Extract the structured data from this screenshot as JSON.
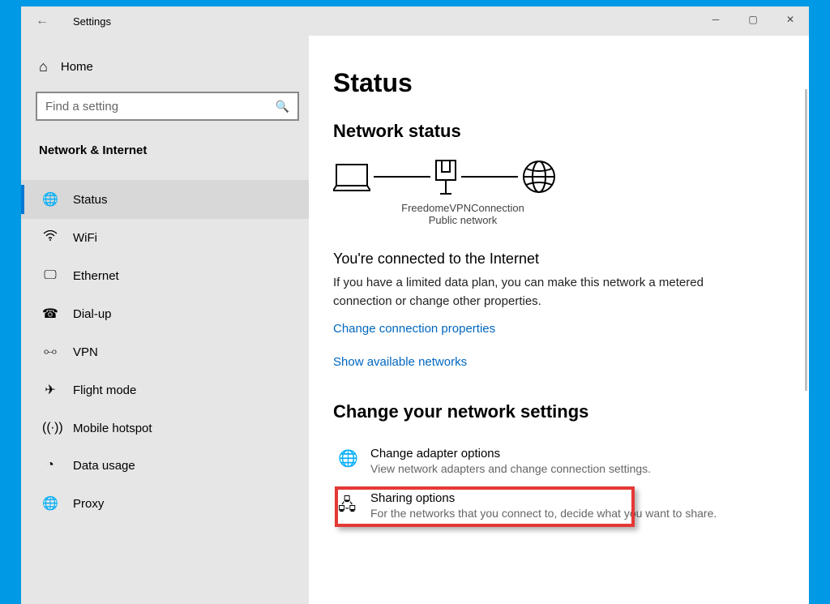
{
  "titlebar": {
    "title": "Settings"
  },
  "sidebar": {
    "home": "Home",
    "search_placeholder": "Find a setting",
    "section": "Network & Internet",
    "items": [
      {
        "label": "Status",
        "selected": true
      },
      {
        "label": "WiFi"
      },
      {
        "label": "Ethernet"
      },
      {
        "label": "Dial-up"
      },
      {
        "label": "VPN"
      },
      {
        "label": "Flight mode"
      },
      {
        "label": "Mobile hotspot"
      },
      {
        "label": "Data usage"
      },
      {
        "label": "Proxy"
      }
    ]
  },
  "main": {
    "page_title": "Status",
    "section1": "Network status",
    "connection_name": "FreedomeVPNConnection",
    "connection_type": "Public network",
    "connected_title": "You're connected to the Internet",
    "connected_desc": "If you have a limited data plan, you can make this network a metered connection or change other properties.",
    "link_change_props": "Change connection properties",
    "link_show_networks": "Show available networks",
    "section2": "Change your network settings",
    "rows": [
      {
        "title": "Change adapter options",
        "desc": "View network adapters and change connection settings."
      },
      {
        "title": "Sharing options",
        "desc": "For the networks that you connect to, decide what you want to share."
      }
    ]
  }
}
